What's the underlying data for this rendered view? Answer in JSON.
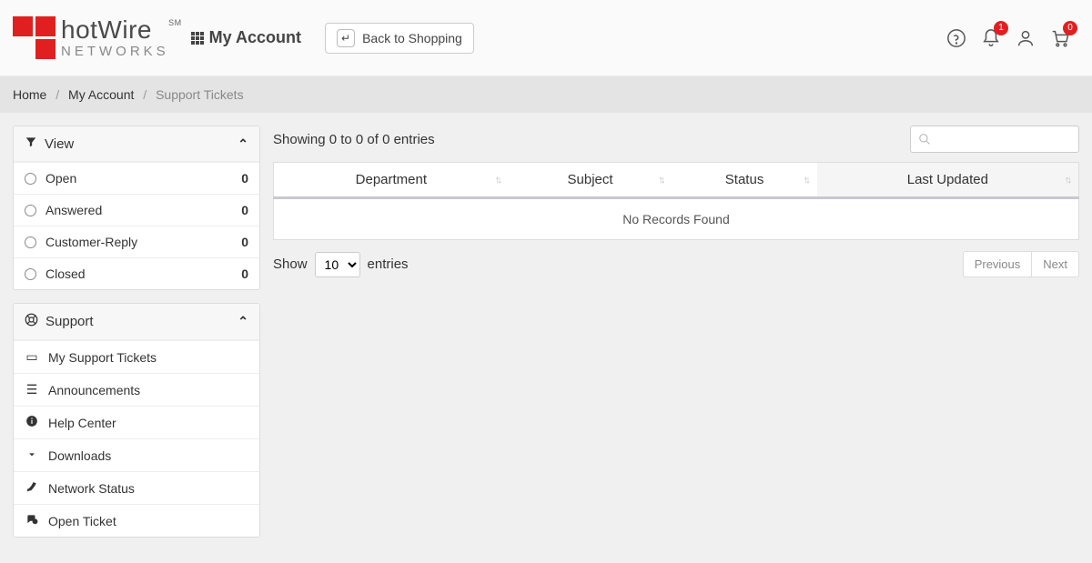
{
  "header": {
    "logo_primary": "hotWire",
    "logo_sm": "SM",
    "logo_secondary": "NETWORKS",
    "my_account_label": "My Account",
    "back_label": "Back to Shopping",
    "notification_badge": "1",
    "cart_badge": "0"
  },
  "breadcrumb": {
    "home": "Home",
    "my_account": "My Account",
    "current": "Support Tickets"
  },
  "sidebar": {
    "view_panel": {
      "title": "View",
      "items": [
        {
          "label": "Open",
          "count": "0"
        },
        {
          "label": "Answered",
          "count": "0"
        },
        {
          "label": "Customer-Reply",
          "count": "0"
        },
        {
          "label": "Closed",
          "count": "0"
        }
      ]
    },
    "support_panel": {
      "title": "Support",
      "items": [
        {
          "label": "My Support Tickets"
        },
        {
          "label": "Announcements"
        },
        {
          "label": "Help Center"
        },
        {
          "label": "Downloads"
        },
        {
          "label": "Network Status"
        },
        {
          "label": "Open Ticket"
        }
      ]
    }
  },
  "main": {
    "entries_summary": "Showing 0 to 0 of 0 entries",
    "columns": [
      "Department",
      "Subject",
      "Status",
      "Last Updated"
    ],
    "no_records": "No Records Found",
    "show_label": "Show",
    "entries_label": "entries",
    "page_size": "10",
    "prev_label": "Previous",
    "next_label": "Next"
  }
}
